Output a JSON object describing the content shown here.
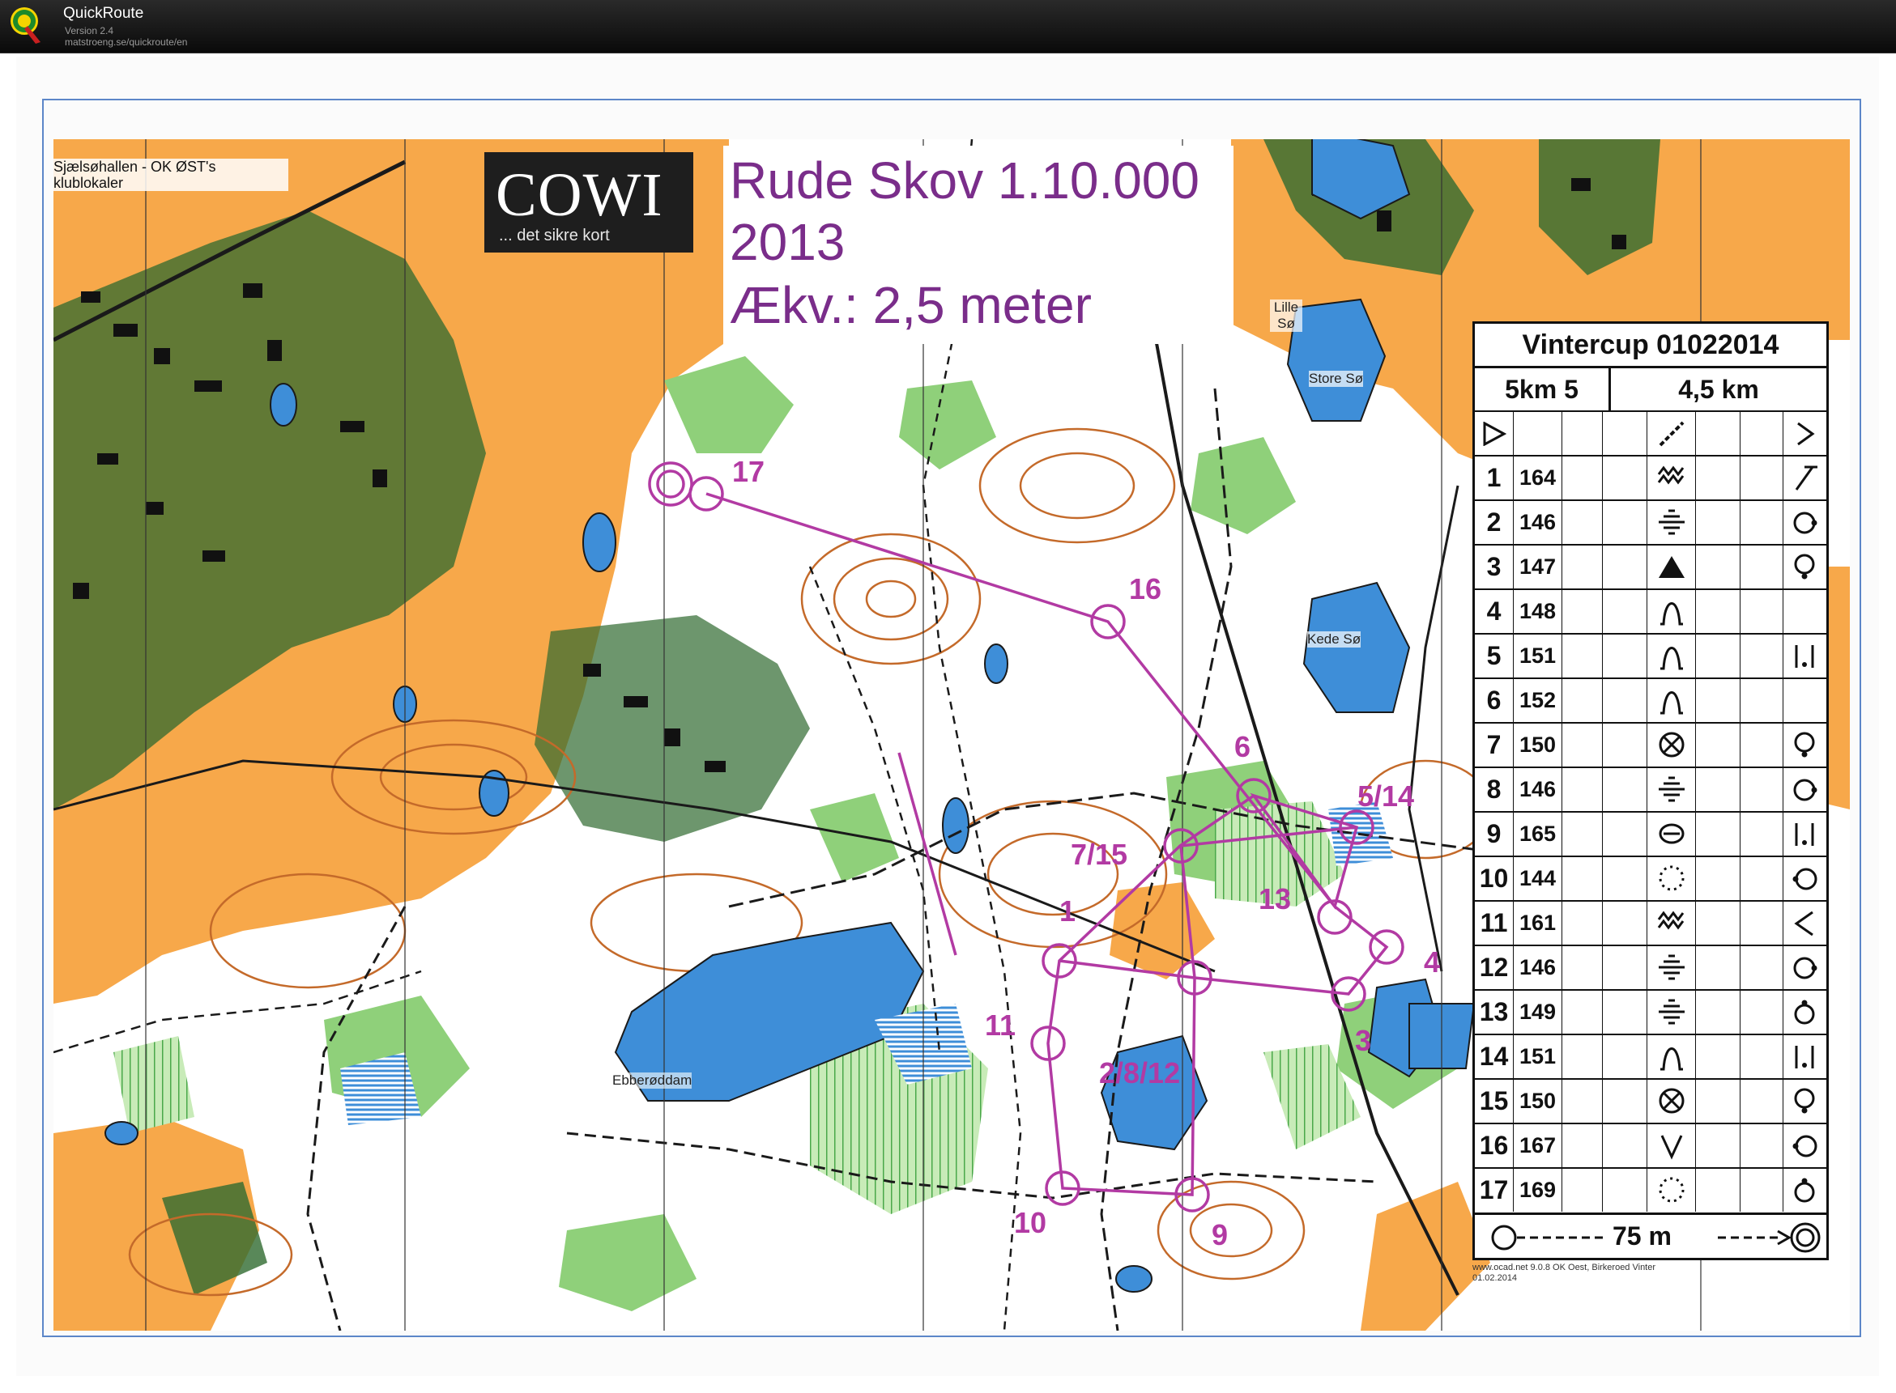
{
  "app": {
    "name": "QuickRoute",
    "version": "Version 2.4",
    "url": "matstroeng.se/quickroute/en"
  },
  "map": {
    "title_lines": [
      "Rude Skov 1.10.000",
      "2013",
      "Ækv.: 2,5 meter"
    ],
    "logo": {
      "name": "COWI",
      "tagline": "... det sikre kort"
    },
    "club_label": "Sjælsøhallen - OK ØST's klublokaler",
    "place_names": {
      "lille_so": "Lille Sø",
      "store_so": "Store Sø",
      "kede_so": "Kede Sø",
      "ebberoddam": "Ebberøddam"
    },
    "print_note": "www.ocad.net 9.0.8 OK Oest, Birkeroed\nVinter 01.02.2014",
    "colors": {
      "open_land": "#f7a84a",
      "forest": "#ffffff",
      "green": "#8fd07a",
      "dark_green": "#2f6a2f",
      "water": "#3e8ed8",
      "contour": "#c46a2a",
      "course": "#b23aa3",
      "frame": "#5c86c8"
    },
    "control_labels": [
      {
        "text": "17"
      },
      {
        "text": "16"
      },
      {
        "text": "6"
      },
      {
        "text": "5/14"
      },
      {
        "text": "7/15"
      },
      {
        "text": "13"
      },
      {
        "text": "1"
      },
      {
        "text": "4"
      },
      {
        "text": "3"
      },
      {
        "text": "11"
      },
      {
        "text": "2/8/12"
      },
      {
        "text": "10"
      },
      {
        "text": "9"
      }
    ]
  },
  "description_sheet": {
    "event": "Vintercup 01022014",
    "course": "5km 5",
    "length": "4,5 km",
    "start_symbol": "start-triangle",
    "controls": [
      {
        "num": "1",
        "code": "164",
        "feature": "stony-ground",
        "location": "foot"
      },
      {
        "num": "2",
        "code": "146",
        "feature": "marsh",
        "location": "east"
      },
      {
        "num": "3",
        "code": "147",
        "feature": "boulder",
        "location": "south"
      },
      {
        "num": "4",
        "code": "148",
        "feature": "knoll",
        "location": ""
      },
      {
        "num": "5",
        "code": "151",
        "feature": "knoll",
        "location": "between"
      },
      {
        "num": "6",
        "code": "152",
        "feature": "knoll",
        "location": ""
      },
      {
        "num": "7",
        "code": "150",
        "feature": "pit",
        "location": "south"
      },
      {
        "num": "8",
        "code": "146",
        "feature": "marsh",
        "location": "east"
      },
      {
        "num": "9",
        "code": "165",
        "feature": "depression",
        "location": "between"
      },
      {
        "num": "10",
        "code": "144",
        "feature": "vegetation-boundary",
        "location": "west"
      },
      {
        "num": "11",
        "code": "161",
        "feature": "stony-ground",
        "location": "corner"
      },
      {
        "num": "12",
        "code": "146",
        "feature": "marsh",
        "location": "east"
      },
      {
        "num": "13",
        "code": "149",
        "feature": "marsh",
        "location": "north"
      },
      {
        "num": "14",
        "code": "151",
        "feature": "knoll",
        "location": "between"
      },
      {
        "num": "15",
        "code": "150",
        "feature": "pit",
        "location": "south"
      },
      {
        "num": "16",
        "code": "167",
        "feature": "reentrant",
        "location": "west"
      },
      {
        "num": "17",
        "code": "169",
        "feature": "vegetation-boundary",
        "location": "north"
      }
    ],
    "finish_distance": "75 m"
  }
}
